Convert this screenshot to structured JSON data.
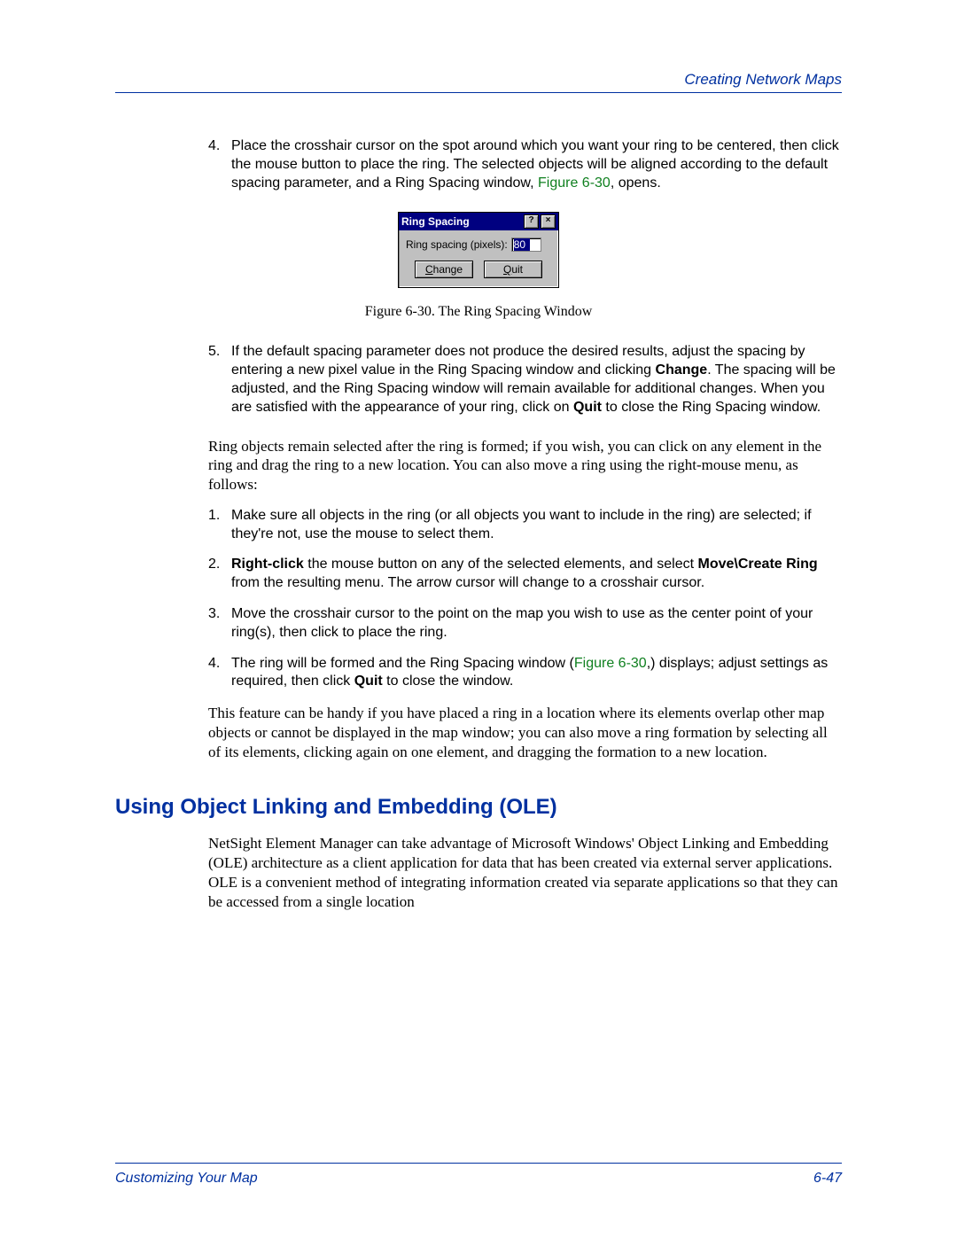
{
  "header": {
    "section_title": "Creating Network Maps"
  },
  "step4": {
    "num": "4.",
    "text_a": "Place the crosshair cursor on the spot around which you want your ring to be centered, then click the mouse button to place the ring. The selected objects will be aligned according to the default spacing parameter, and a Ring Spacing window, ",
    "figref": "Figure 6-30",
    "text_b": ", opens."
  },
  "dialog": {
    "title": "Ring Spacing",
    "help_glyph": "?",
    "close_glyph": "×",
    "label": "Ring spacing (pixels):",
    "value": "80",
    "change": "Change",
    "quit": "Quit"
  },
  "figure_caption": "Figure 6-30.  The Ring Spacing Window",
  "step5": {
    "num": "5.",
    "text_a": "If the default spacing parameter does not produce the desired results, adjust the spacing by entering a new pixel value in the Ring Spacing window and clicking ",
    "bold_a": "Change",
    "text_b": ". The spacing will be adjusted, and the Ring Spacing window will remain available for additional changes. When you are satisfied with the appearance of your ring, click on ",
    "bold_b": "Quit",
    "text_c": " to close the Ring Spacing window."
  },
  "para_after5": "Ring objects remain selected after the ring is formed; if you wish, you can click on any element in the ring and drag the ring to a new location. You can also move a ring using the right-mouse menu, as follows:",
  "move_steps": {
    "s1": {
      "num": "1.",
      "text": "Make sure all objects in the ring (or all objects you want to include in the ring) are selected; if they're not, use the mouse to select them."
    },
    "s2": {
      "num": "2.",
      "bold_a": "Right-click",
      "text_a": " the mouse button on any of the selected elements, and select ",
      "bold_b": "Move\\Create Ring",
      "text_b": " from the resulting menu. The arrow cursor will change to a crosshair cursor."
    },
    "s3": {
      "num": "3.",
      "text": "Move the crosshair cursor to the point on the map you wish to use as the center point of your ring(s), then click to place the ring."
    },
    "s4": {
      "num": "4.",
      "text_a": "The ring will be formed and the Ring Spacing window (",
      "figref": "Figure 6-30",
      "text_b": ",) displays; adjust settings as required, then click ",
      "bold_a": "Quit",
      "text_c": " to close the window."
    }
  },
  "para_after_move": "This feature can be handy if you have placed a ring in a location where its elements overlap other map objects or cannot be displayed in the map window; you can also move a ring formation by selecting all of its elements, clicking again on one element, and dragging the formation to a new location.",
  "h2": "Using Object Linking and Embedding (OLE)",
  "ole_para": "NetSight Element Manager can take advantage of Microsoft Windows' Object Linking and Embedding (OLE) architecture as a client application for data that has been created via external server applications. OLE is a convenient method of integrating information created via separate applications so that they can be accessed from a single location",
  "footer": {
    "left": "Customizing Your Map",
    "right": "6-47"
  }
}
